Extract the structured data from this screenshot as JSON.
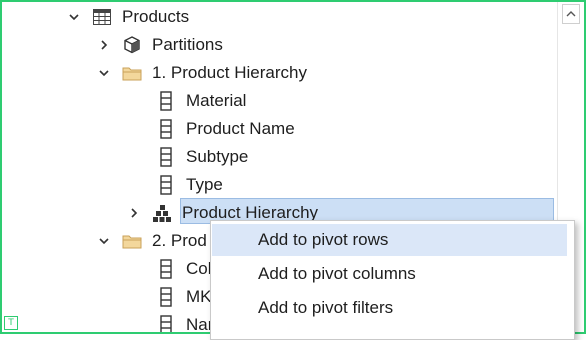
{
  "tree": {
    "items": [
      {
        "label": "Products",
        "icon": "table-icon",
        "expanded": true
      },
      {
        "label": "Partitions",
        "icon": "partitions-cube-icon",
        "expanded": false
      },
      {
        "label": "1. Product Hierarchy",
        "icon": "folder-icon",
        "expanded": true
      },
      {
        "label": "Material",
        "icon": "column-icon"
      },
      {
        "label": "Product Name",
        "icon": "column-icon"
      },
      {
        "label": "Subtype",
        "icon": "column-icon"
      },
      {
        "label": "Type",
        "icon": "column-icon"
      },
      {
        "label": "Product Hierarchy",
        "icon": "hierarchy-icon",
        "expanded": false,
        "selected": true
      },
      {
        "label": "2. Prod",
        "icon": "folder-icon",
        "expanded": true
      },
      {
        "label": "Col",
        "icon": "column-icon"
      },
      {
        "label": "MK",
        "icon": "column-icon"
      },
      {
        "label": "Nar",
        "icon": "column-icon"
      }
    ]
  },
  "context_menu": {
    "items": [
      {
        "label": "Add to pivot rows",
        "hover": true
      },
      {
        "label": "Add to pivot columns"
      },
      {
        "label": "Add to pivot filters"
      }
    ]
  },
  "colors": {
    "border_accent": "#2ecc71",
    "selection": "#ccdff5",
    "menu_hover": "#dbe7f8",
    "folder": "#e8c07a"
  }
}
